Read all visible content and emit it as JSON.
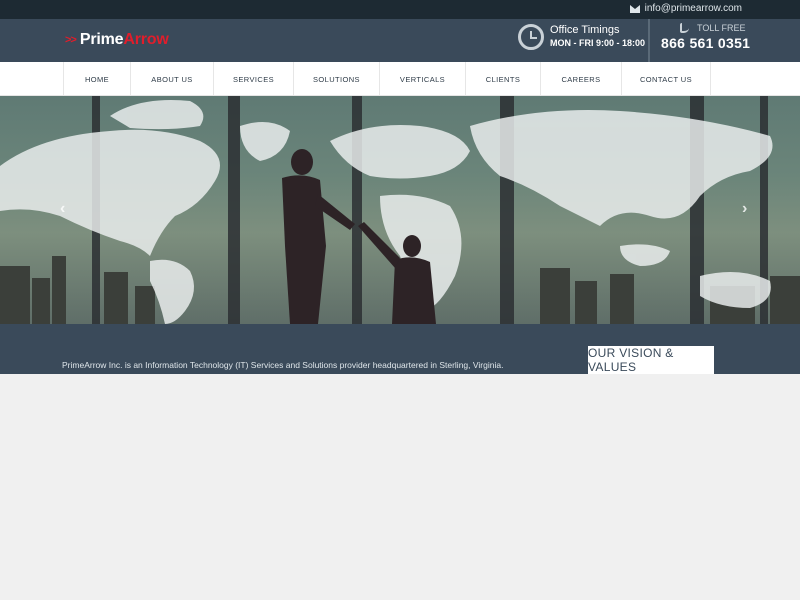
{
  "topbar": {
    "email": "info@primearrow.com"
  },
  "header": {
    "logo": {
      "arrows": ">>",
      "prime": "Prime",
      "arrow": "Arrow"
    },
    "office": {
      "title": "Office Timings",
      "hours": "MON - FRI 9:00 - 18:00"
    },
    "tollfree": {
      "label": "TOLL FREE",
      "number": "866 561 0351"
    }
  },
  "nav": {
    "items": [
      {
        "label": "HOME"
      },
      {
        "label": "ABOUT US"
      },
      {
        "label": "SERVICES"
      },
      {
        "label": "SOLUTIONS"
      },
      {
        "label": "VERTICALS"
      },
      {
        "label": "CLIENTS"
      },
      {
        "label": "CAREERS"
      },
      {
        "label": "CONTACT US"
      }
    ]
  },
  "hero": {
    "prev": "‹",
    "next": "›"
  },
  "about": {
    "text": "PrimeArrow Inc. is an Information Technology (IT) Services and Solutions provider headquartered in Sterling, Virginia.",
    "button": "OUR VISION & VALUES"
  },
  "colors": {
    "header_bg": "#3a4a5a",
    "topbar_bg": "#1d2a33",
    "accent": "#e11d2b"
  },
  "icons": {
    "email": "envelope-icon",
    "clock": "clock-icon",
    "phone": "phone-icon"
  }
}
